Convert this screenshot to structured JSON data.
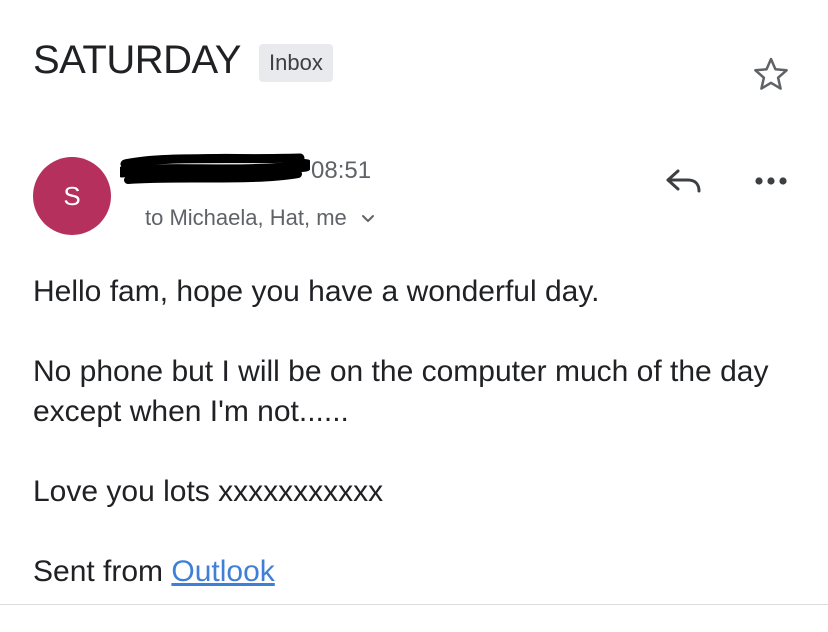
{
  "message": {
    "subject": "SATURDAY",
    "label": "Inbox",
    "sender_initial": "S",
    "time": "08:51",
    "recipients": "to Michaela, Hat, me",
    "body": {
      "line1": "Hello fam, hope you have a wonderful day.",
      "line2": "No phone but I will be on the computer much of the day except when I'm not......",
      "line3": "Love you lots xxxxxxxxxxx",
      "signature_prefix": "Sent from ",
      "signature_link": "Outlook"
    }
  },
  "colors": {
    "avatar": "#b5305d",
    "link": "#3f7fd8",
    "chip_background": "#e8eaed",
    "secondary_text": "#5f6368"
  },
  "icons": {
    "star": "star-outline-icon",
    "reply": "reply-arrow-icon",
    "more": "more-horizontal-icon",
    "expand": "chevron-down-icon"
  }
}
